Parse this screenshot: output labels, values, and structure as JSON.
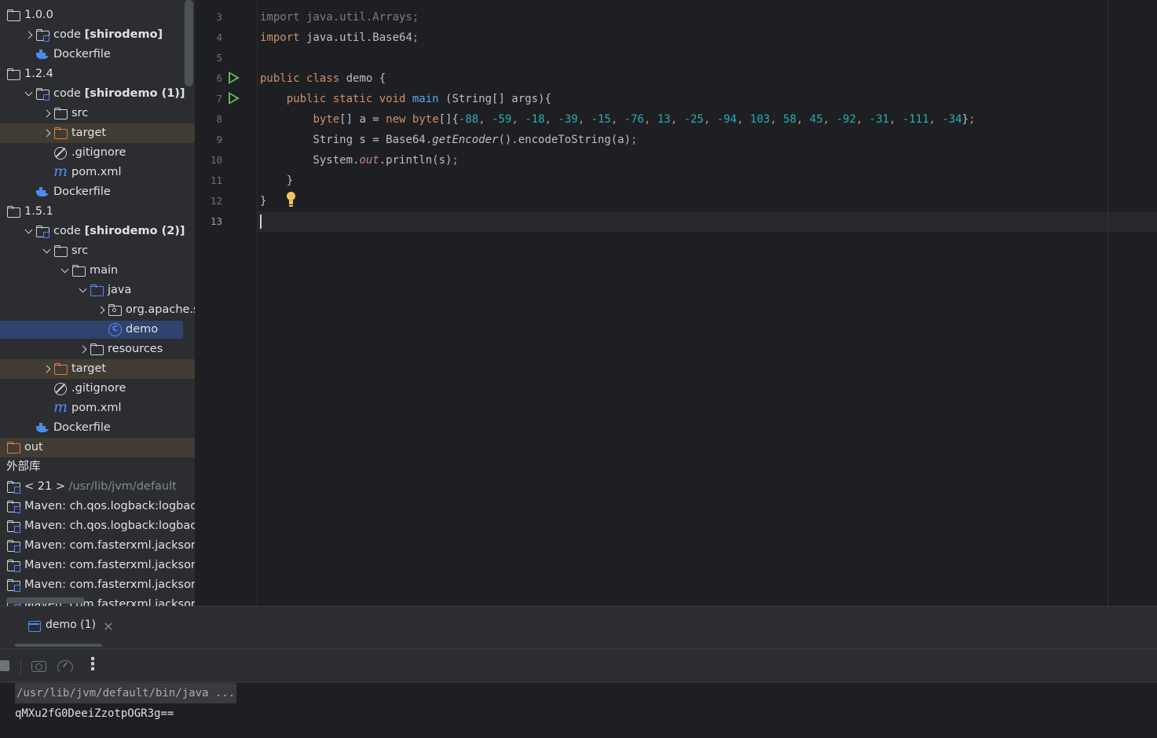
{
  "tree": {
    "rows": [
      {
        "indent": 0,
        "chev": "",
        "icon": "folder",
        "label": "1.0.0",
        "bold": "",
        "suffix": "",
        "excluded": false
      },
      {
        "indent": 1,
        "chev": "closed",
        "icon": "module",
        "label": "code ",
        "bold": "[shirodemo]",
        "suffix": "",
        "excluded": false
      },
      {
        "indent": 1,
        "chev": "",
        "icon": "docker",
        "label": "Dockerfile",
        "bold": "",
        "suffix": "",
        "excluded": false
      },
      {
        "indent": 0,
        "chev": "",
        "icon": "folder",
        "label": "1.2.4",
        "bold": "",
        "suffix": "",
        "excluded": false
      },
      {
        "indent": 1,
        "chev": "open",
        "icon": "module",
        "label": "code ",
        "bold": "[shirodemo (1)]",
        "suffix": "",
        "excluded": false
      },
      {
        "indent": 2,
        "chev": "closed",
        "icon": "folder",
        "label": "src",
        "bold": "",
        "suffix": "",
        "excluded": false
      },
      {
        "indent": 2,
        "chev": "closed",
        "icon": "folder-orange",
        "label": "target",
        "bold": "",
        "suffix": "",
        "excluded": true
      },
      {
        "indent": 2,
        "chev": "",
        "icon": "gitignore",
        "label": ".gitignore",
        "bold": "",
        "suffix": "",
        "excluded": false
      },
      {
        "indent": 2,
        "chev": "",
        "icon": "maven",
        "label": "pom.xml",
        "bold": "",
        "suffix": "",
        "excluded": false
      },
      {
        "indent": 1,
        "chev": "",
        "icon": "docker",
        "label": "Dockerfile",
        "bold": "",
        "suffix": "",
        "excluded": false
      },
      {
        "indent": 0,
        "chev": "",
        "icon": "folder",
        "label": "1.5.1",
        "bold": "",
        "suffix": "",
        "excluded": false
      },
      {
        "indent": 1,
        "chev": "open",
        "icon": "module",
        "label": "code ",
        "bold": "[shirodemo (2)]",
        "suffix": "",
        "excluded": false
      },
      {
        "indent": 2,
        "chev": "open",
        "icon": "folder",
        "label": "src",
        "bold": "",
        "suffix": "",
        "excluded": false
      },
      {
        "indent": 3,
        "chev": "open",
        "icon": "folder",
        "label": "main",
        "bold": "",
        "suffix": "",
        "excluded": false
      },
      {
        "indent": 4,
        "chev": "open",
        "icon": "folder-blue",
        "label": "java",
        "bold": "",
        "suffix": "",
        "excluded": false
      },
      {
        "indent": 5,
        "chev": "closed",
        "icon": "package",
        "label": "org.apache.shiro",
        "bold": "",
        "suffix": "",
        "excluded": false
      },
      {
        "indent": 5,
        "chev": "",
        "icon": "class",
        "label": "demo",
        "bold": "",
        "suffix": "",
        "excluded": false,
        "selected": true
      },
      {
        "indent": 4,
        "chev": "closed",
        "icon": "folder",
        "label": "resources",
        "bold": "",
        "suffix": "",
        "excluded": false
      },
      {
        "indent": 2,
        "chev": "closed",
        "icon": "folder-orange",
        "label": "target",
        "bold": "",
        "suffix": "",
        "excluded": true
      },
      {
        "indent": 2,
        "chev": "",
        "icon": "gitignore",
        "label": ".gitignore",
        "bold": "",
        "suffix": "",
        "excluded": false
      },
      {
        "indent": 2,
        "chev": "",
        "icon": "maven",
        "label": "pom.xml",
        "bold": "",
        "suffix": "",
        "excluded": false
      },
      {
        "indent": 1,
        "chev": "",
        "icon": "docker",
        "label": "Dockerfile",
        "bold": "",
        "suffix": "",
        "excluded": false
      },
      {
        "indent": 0,
        "chev": "",
        "icon": "folder-orange",
        "label": "out",
        "bold": "",
        "suffix": "",
        "excluded": true
      },
      {
        "indent": -1,
        "chev": "",
        "icon": "none",
        "label": "外部库",
        "bold": "",
        "suffix": "",
        "excluded": false
      },
      {
        "indent": 0,
        "chev": "",
        "icon": "library",
        "label": "< 21 > ",
        "bold": "",
        "suffix": "/usr/lib/jvm/default",
        "excluded": false
      },
      {
        "indent": 0,
        "chev": "",
        "icon": "library",
        "label": "Maven: ch.qos.logback:logback-classic",
        "bold": "",
        "suffix": "",
        "excluded": false
      },
      {
        "indent": 0,
        "chev": "",
        "icon": "library",
        "label": "Maven: ch.qos.logback:logback-core",
        "bold": "",
        "suffix": "",
        "excluded": false
      },
      {
        "indent": 0,
        "chev": "",
        "icon": "library",
        "label": "Maven: com.fasterxml.jackson.core",
        "bold": "",
        "suffix": "",
        "excluded": false
      },
      {
        "indent": 0,
        "chev": "",
        "icon": "library",
        "label": "Maven: com.fasterxml.jackson.core",
        "bold": "",
        "suffix": "",
        "excluded": false
      },
      {
        "indent": 0,
        "chev": "",
        "icon": "library",
        "label": "Maven: com.fasterxml.jackson.core",
        "bold": "",
        "suffix": "",
        "excluded": false
      },
      {
        "indent": 0,
        "chev": "",
        "icon": "library",
        "label": "Maven: com.fasterxml.jackson.core",
        "bold": "",
        "suffix": "",
        "excluded": false
      }
    ]
  },
  "editor": {
    "line_numbers": [
      "3",
      "4",
      "5",
      "6",
      "7",
      "8",
      "9",
      "10",
      "11",
      "12",
      "13"
    ],
    "current_line": "13",
    "run_gutter_lines": [
      "6",
      "7"
    ],
    "code": [
      {
        "n": "3",
        "parts": [
          {
            "t": "import java.util.Arrays;",
            "c": "dimmed"
          }
        ]
      },
      {
        "n": "4",
        "parts": [
          {
            "t": "import",
            "c": "kw"
          },
          {
            "t": " java.util.Base64",
            "c": ""
          },
          {
            "t": ";",
            "c": "kw"
          }
        ]
      },
      {
        "n": "5",
        "parts": []
      },
      {
        "n": "6",
        "parts": [
          {
            "t": "public class",
            "c": "kw"
          },
          {
            "t": " demo {",
            "c": ""
          }
        ]
      },
      {
        "n": "7",
        "parts": [
          {
            "t": "    ",
            "c": ""
          },
          {
            "t": "public static void",
            "c": "kw"
          },
          {
            "t": " ",
            "c": ""
          },
          {
            "t": "main",
            "c": "fn"
          },
          {
            "t": " (String[] args){",
            "c": ""
          }
        ]
      },
      {
        "n": "8",
        "parts": [
          {
            "t": "        ",
            "c": ""
          },
          {
            "t": "byte",
            "c": "kw"
          },
          {
            "t": "[] a = ",
            "c": ""
          },
          {
            "t": "new",
            "c": "kw"
          },
          {
            "t": " ",
            "c": ""
          },
          {
            "t": "byte",
            "c": "kw"
          },
          {
            "t": "[]{",
            "c": ""
          },
          {
            "t": "-88",
            "c": "num"
          },
          {
            "t": ", ",
            "c": "kw"
          },
          {
            "t": "-59",
            "c": "num"
          },
          {
            "t": ", ",
            "c": "kw"
          },
          {
            "t": "-18",
            "c": "num"
          },
          {
            "t": ", ",
            "c": "kw"
          },
          {
            "t": "-39",
            "c": "num"
          },
          {
            "t": ", ",
            "c": "kw"
          },
          {
            "t": "-15",
            "c": "num"
          },
          {
            "t": ", ",
            "c": "kw"
          },
          {
            "t": "-76",
            "c": "num"
          },
          {
            "t": ", ",
            "c": "kw"
          },
          {
            "t": "13",
            "c": "num"
          },
          {
            "t": ", ",
            "c": "kw"
          },
          {
            "t": "-25",
            "c": "num"
          },
          {
            "t": ", ",
            "c": "kw"
          },
          {
            "t": "-94",
            "c": "num"
          },
          {
            "t": ", ",
            "c": "kw"
          },
          {
            "t": "103",
            "c": "num"
          },
          {
            "t": ", ",
            "c": "kw"
          },
          {
            "t": "58",
            "c": "num"
          },
          {
            "t": ", ",
            "c": "kw"
          },
          {
            "t": "45",
            "c": "num"
          },
          {
            "t": ", ",
            "c": "kw"
          },
          {
            "t": "-92",
            "c": "num"
          },
          {
            "t": ", ",
            "c": "kw"
          },
          {
            "t": "-31",
            "c": "num"
          },
          {
            "t": ", ",
            "c": "kw"
          },
          {
            "t": "-111",
            "c": "num"
          },
          {
            "t": ", ",
            "c": "kw"
          },
          {
            "t": "-34",
            "c": "num"
          },
          {
            "t": "}",
            "c": ""
          },
          {
            "t": ";",
            "c": "kw"
          }
        ]
      },
      {
        "n": "9",
        "parts": [
          {
            "t": "        String s = Base64.",
            "c": ""
          },
          {
            "t": "getEncoder",
            "c": "it"
          },
          {
            "t": "().encodeToString(a)",
            "c": ""
          },
          {
            "t": ";",
            "c": "kw"
          }
        ]
      },
      {
        "n": "10",
        "parts": [
          {
            "t": "        System.",
            "c": ""
          },
          {
            "t": "out",
            "c": "stat"
          },
          {
            "t": ".println(s)",
            "c": ""
          },
          {
            "t": ";",
            "c": "kw"
          }
        ]
      },
      {
        "n": "11",
        "parts": [
          {
            "t": "    }",
            "c": ""
          }
        ]
      },
      {
        "n": "12",
        "parts": [
          {
            "t": "}",
            "c": ""
          }
        ]
      },
      {
        "n": "13",
        "parts": []
      }
    ]
  },
  "run": {
    "tab_label": "demo (1)",
    "close_glyph": "×",
    "more_glyph": "⋮",
    "command": "/usr/lib/jvm/default/bin/java ...",
    "output": "qMXu2fG0DeeiZzotpOGR3g=="
  }
}
